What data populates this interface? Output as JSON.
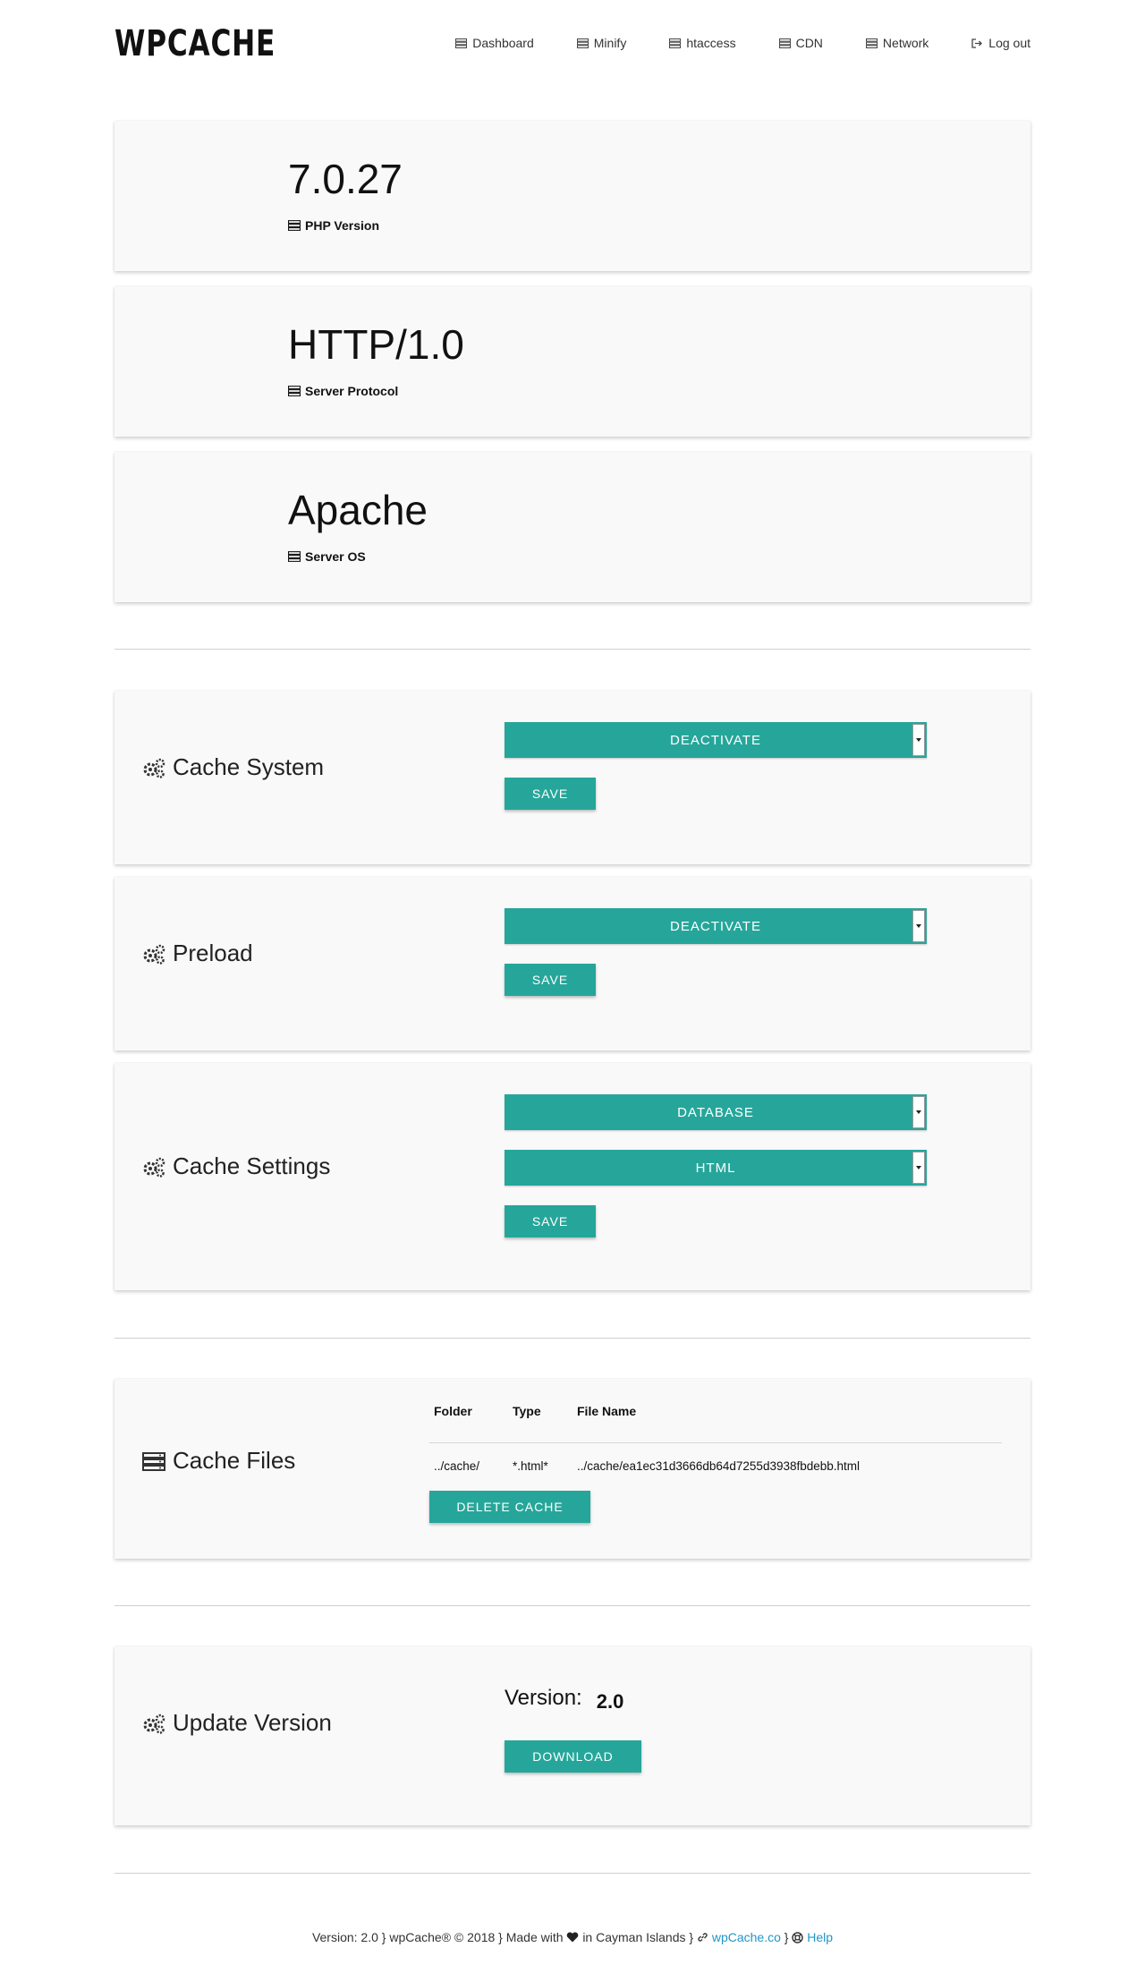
{
  "header": {
    "logo": "WPCACHE",
    "nav": [
      {
        "label": "Dashboard",
        "icon": "server-icon"
      },
      {
        "label": "Minify",
        "icon": "server-icon"
      },
      {
        "label": "htaccess",
        "icon": "server-icon"
      },
      {
        "label": "CDN",
        "icon": "server-icon"
      },
      {
        "label": "Network",
        "icon": "server-icon"
      },
      {
        "label": "Log out",
        "icon": "sign-out-icon"
      }
    ]
  },
  "stats": [
    {
      "value": "7.0.27",
      "label": "PHP Version"
    },
    {
      "value": "HTTP/1.0",
      "label": "Server Protocol"
    },
    {
      "value": "Apache",
      "label": "Server OS"
    }
  ],
  "cache_system": {
    "title": "Cache System",
    "select_value": "DEACTIVATE",
    "save_label": "SAVE"
  },
  "preload": {
    "title": "Preload",
    "select_value": "DEACTIVATE",
    "save_label": "SAVE"
  },
  "cache_settings": {
    "title": "Cache Settings",
    "select_storage": "DATABASE",
    "select_format": "HTML",
    "save_label": "SAVE"
  },
  "cache_files": {
    "title": "Cache Files",
    "columns": [
      "Folder",
      "Type",
      "File Name"
    ],
    "row": [
      "../cache/",
      "*.html*",
      "../cache/ea1ec31d3666db64d7255d3938fbdebb.html"
    ],
    "delete_label": "DELETE CACHE"
  },
  "update": {
    "title": "Update Version",
    "version_label": "Version:",
    "version_value": "2.0",
    "download_label": "DOWNLOAD"
  },
  "footer": {
    "prefix": "Version: 2.0 } wpCache® © 2018 } Made with",
    "middle": "in Cayman Islands }",
    "site_link": "wpCache.co",
    "sep": "}",
    "help_link": "Help"
  },
  "colors": {
    "accent": "#26a69a",
    "link": "#2196c9",
    "card_bg": "#f9f9f9"
  }
}
